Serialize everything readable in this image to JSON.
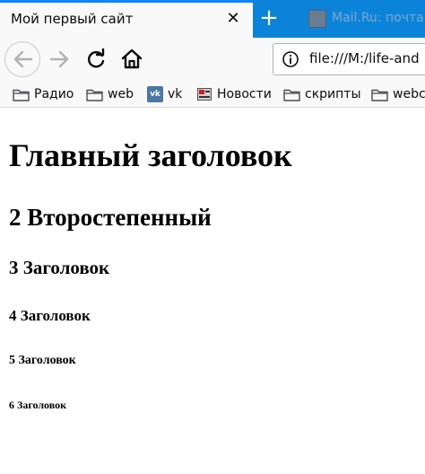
{
  "tabs": {
    "active": {
      "title": "Мой первый сайт",
      "close_glyph": "✕"
    },
    "new_tab_glyph": "+",
    "inactive": {
      "title": "Mail.Ru: почта"
    }
  },
  "navbar": {
    "back_icon": "back-arrow-icon",
    "forward_icon": "forward-arrow-icon",
    "reload_icon": "reload-icon",
    "home_icon": "home-icon",
    "url": "file:///M:/life-and"
  },
  "bookmarks": [
    {
      "label": "Радио",
      "icon": "folder-icon"
    },
    {
      "label": "web",
      "icon": "folder-icon"
    },
    {
      "label": "vk",
      "icon": "vk-icon"
    },
    {
      "label": "Новости",
      "icon": "news-icon"
    },
    {
      "label": "скрипты",
      "icon": "folder-icon"
    },
    {
      "label": "webc",
      "icon": "folder-icon"
    }
  ],
  "content": {
    "h1": "Главный заголовок",
    "h2": "2 Второстепенный",
    "h3": "3 Заголовок",
    "h4": "4 Заголовок",
    "h5": "5 Заголовок",
    "h6": "6 Заголовок"
  },
  "colors": {
    "tabstrip": "#0a83d8",
    "tab_accent": "#0a84ff",
    "toolbar": "#f9f9fa",
    "vk_brand": "#4a76a8"
  }
}
